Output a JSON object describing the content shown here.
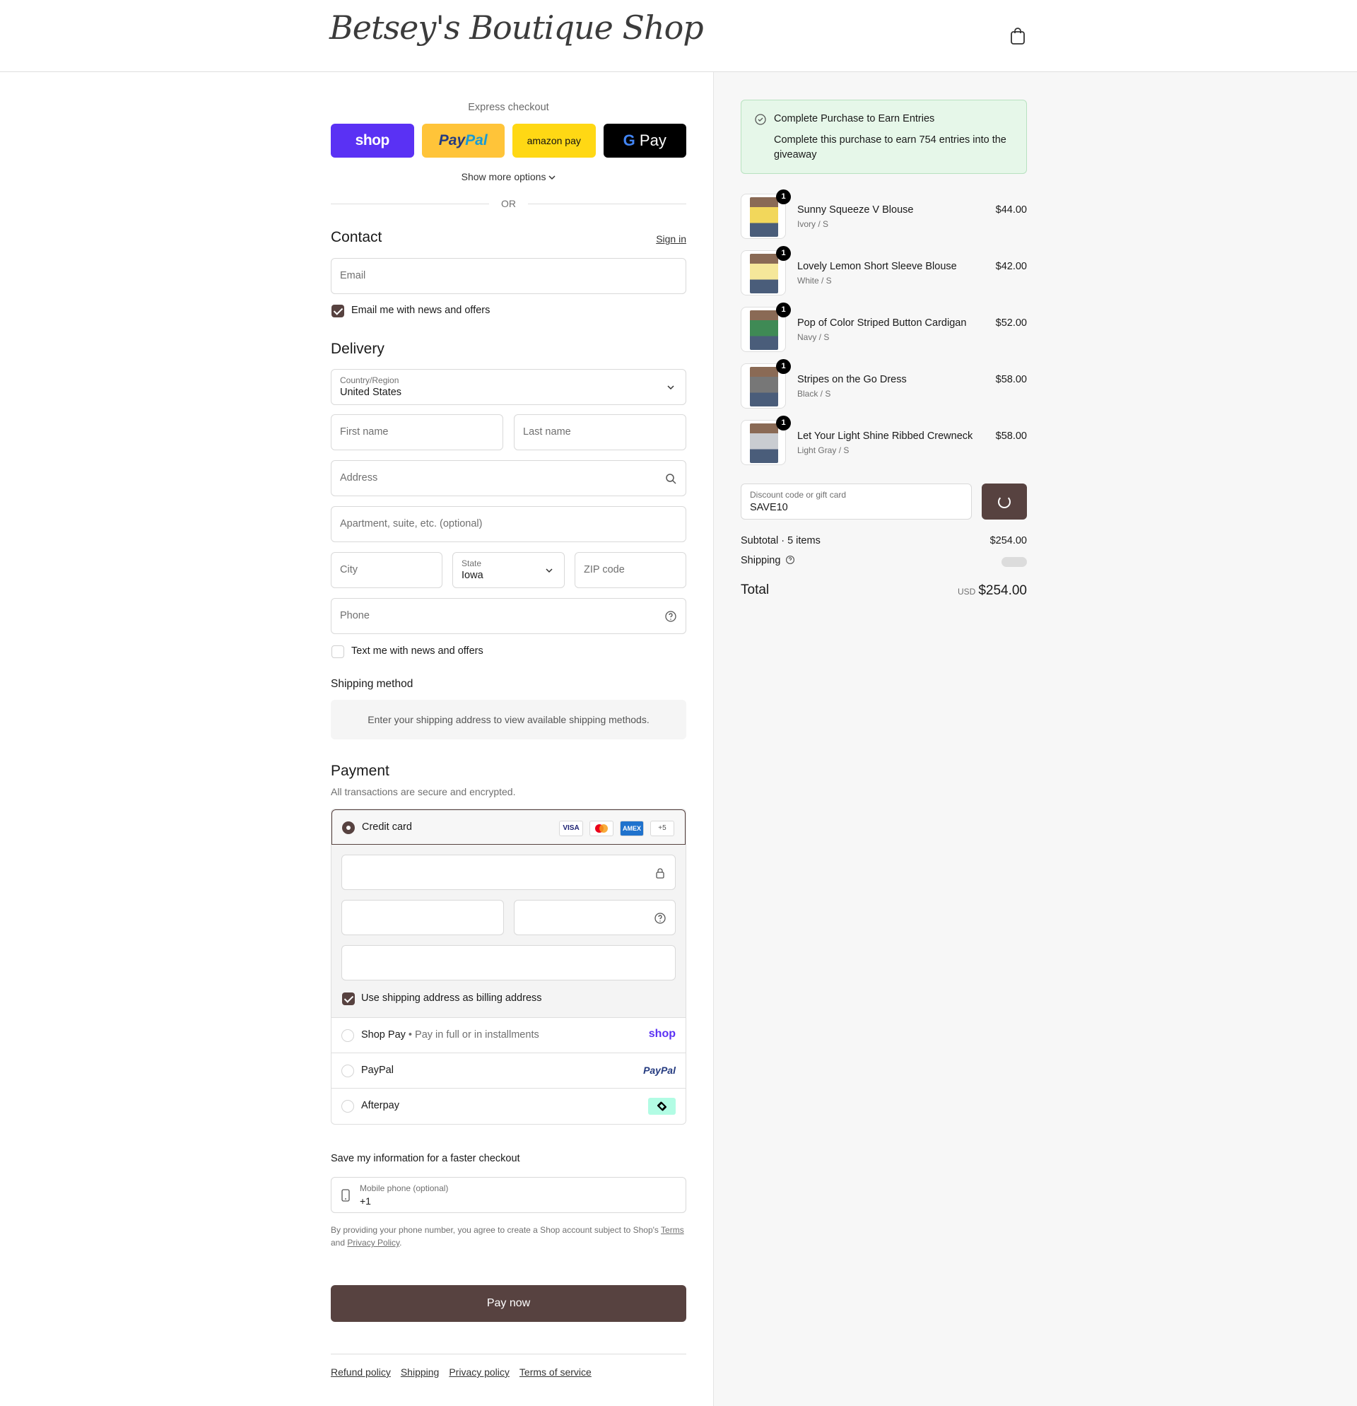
{
  "header": {
    "logo_text": "Betsey's Boutique Shop",
    "cart_icon": "shopping-bag-icon"
  },
  "express": {
    "title": "Express checkout",
    "buttons": {
      "shop": "shop",
      "paypal_a": "Pay",
      "paypal_b": "Pal",
      "amazon": "amazon pay",
      "gpay_g": "G",
      "gpay": "Pay"
    },
    "more_options": "Show more options",
    "or": "OR"
  },
  "contact": {
    "title": "Contact",
    "sign_in": "Sign in",
    "email_placeholder": "Email",
    "news_checkbox_label": "Email me with news and offers",
    "news_checked": true
  },
  "delivery": {
    "title": "Delivery",
    "country_label": "Country/Region",
    "country_value": "United States",
    "first_name_placeholder": "First name",
    "last_name_placeholder": "Last name",
    "address_placeholder": "Address",
    "apartment_placeholder": "Apartment, suite, etc. (optional)",
    "city_placeholder": "City",
    "state_label": "State",
    "state_value": "Iowa",
    "zip_placeholder": "ZIP code",
    "phone_placeholder": "Phone",
    "text_checkbox_label": "Text me with news and offers",
    "text_checked": false
  },
  "shipping_method": {
    "title": "Shipping method",
    "message": "Enter your shipping address to view available shipping methods."
  },
  "payment": {
    "title": "Payment",
    "subtitle": "All transactions are secure and encrypted.",
    "credit_card_label": "Credit card",
    "card_badges": [
      "VISA",
      "MC",
      "AMEX",
      "+5"
    ],
    "billing_checkbox_label": "Use shipping address as billing address",
    "billing_checked": true,
    "shop_pay_label": "Shop Pay",
    "shop_pay_sub": "Pay in full or in installments",
    "shop_pay_logo": "shop",
    "paypal_label": "PayPal",
    "paypal_logo": "PayPal",
    "afterpay_label": "Afterpay"
  },
  "save_info": {
    "title": "Save my information for a faster checkout",
    "phone_label": "Mobile phone (optional)",
    "phone_value": "+1",
    "legal_text": "By providing your phone number, you agree to create a Shop account subject to Shop's",
    "terms_link": "Terms",
    "and_text": "and",
    "privacy_link": "Privacy Policy",
    "period": "."
  },
  "pay_now": "Pay now",
  "footer": {
    "links": [
      "Refund policy",
      "Shipping",
      "Privacy policy",
      "Terms of service"
    ]
  },
  "entries": {
    "title": "Complete Purchase to Earn Entries",
    "body": "Complete this purchase to earn 754 entries into the giveaway"
  },
  "cart_items": [
    {
      "name": "Sunny Squeeze V Blouse",
      "variant": "Ivory / S",
      "price": "$44.00",
      "qty": "1",
      "color": "#f2d75b"
    },
    {
      "name": "Lovely Lemon Short Sleeve Blouse",
      "variant": "White / S",
      "price": "$42.00",
      "qty": "1",
      "color": "#f5e79a"
    },
    {
      "name": "Pop of Color Striped Button Cardigan",
      "variant": "Navy / S",
      "price": "$52.00",
      "qty": "1",
      "color": "#3f8a55"
    },
    {
      "name": "Stripes on the Go Dress",
      "variant": "Black / S",
      "price": "$58.00",
      "qty": "1",
      "color": "#777777"
    },
    {
      "name": "Let Your Light Shine Ribbed Crewneck",
      "variant": "Light Gray / S",
      "price": "$58.00",
      "qty": "1",
      "color": "#c9ccd1"
    }
  ],
  "discount": {
    "label": "Discount code or gift card",
    "value": "SAVE10"
  },
  "summary": {
    "subtotal_label": "Subtotal · 5 items",
    "subtotal_value": "$254.00",
    "shipping_label": "Shipping",
    "total_label": "Total",
    "currency": "USD",
    "total_value": "$254.00"
  },
  "colors": {
    "accent": "#574240",
    "shop_pay": "#5a31f4",
    "paypal": "#ffc439",
    "amazon": "#ffd814",
    "entries_bg": "#e6f7e9"
  }
}
